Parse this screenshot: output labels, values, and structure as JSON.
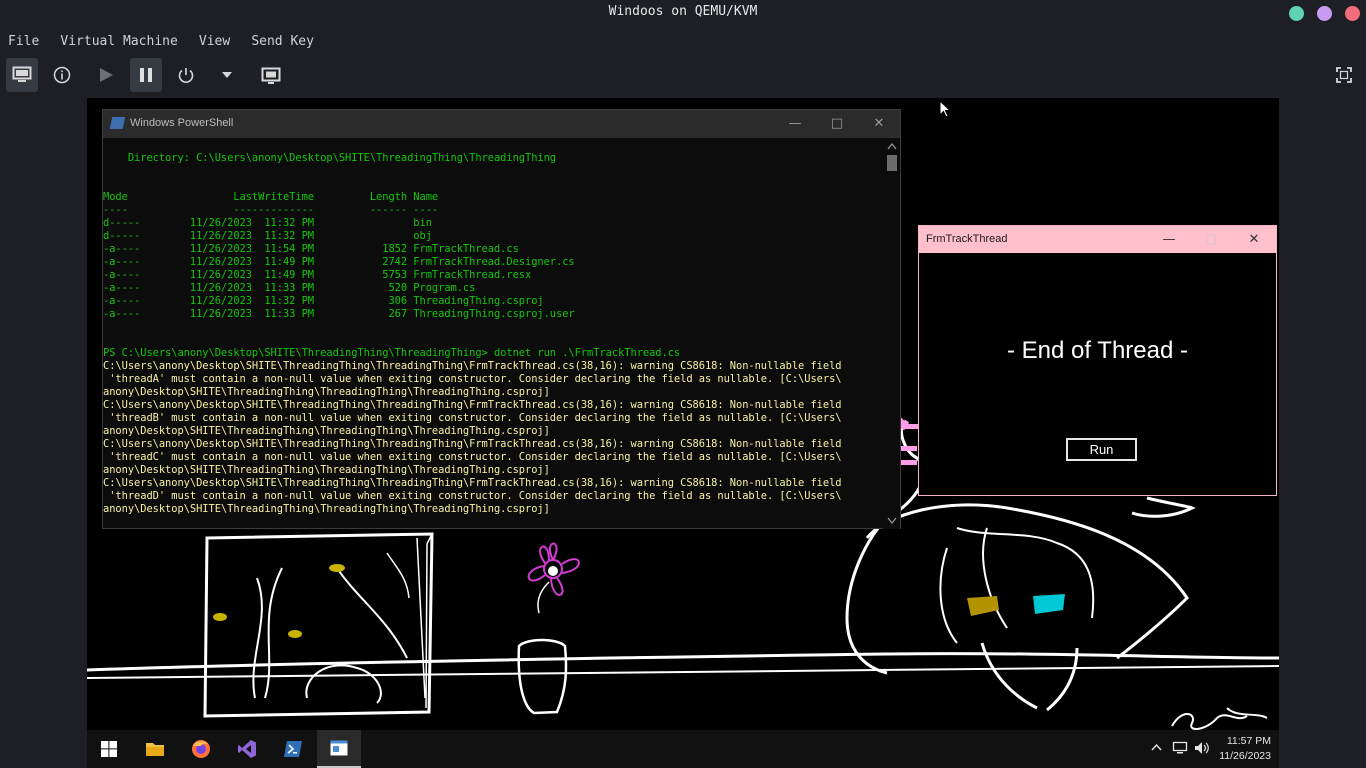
{
  "host": {
    "title": "Windoos on QEMU/KVM",
    "menu": [
      "File",
      "Virtual Machine",
      "View",
      "Send Key"
    ],
    "window_dots": [
      "#5fd3b3",
      "#c79cf2",
      "#f26d7d"
    ]
  },
  "powershell": {
    "title": "Windows PowerShell",
    "lines": [
      {
        "c": "g",
        "t": ""
      },
      {
        "c": "g",
        "t": "    Directory: C:\\Users\\anony\\Desktop\\SHITE\\ThreadingThing\\ThreadingThing"
      },
      {
        "c": "g",
        "t": ""
      },
      {
        "c": "g",
        "t": ""
      },
      {
        "c": "g",
        "t": "Mode                 LastWriteTime         Length Name"
      },
      {
        "c": "g",
        "t": "----                 -------------         ------ ----"
      },
      {
        "c": "g",
        "t": "d-----        11/26/2023  11:32 PM                bin"
      },
      {
        "c": "g",
        "t": "d-----        11/26/2023  11:32 PM                obj"
      },
      {
        "c": "g",
        "t": "-a----        11/26/2023  11:54 PM           1852 FrmTrackThread.cs"
      },
      {
        "c": "g",
        "t": "-a----        11/26/2023  11:49 PM           2742 FrmTrackThread.Designer.cs"
      },
      {
        "c": "g",
        "t": "-a----        11/26/2023  11:49 PM           5753 FrmTrackThread.resx"
      },
      {
        "c": "g",
        "t": "-a----        11/26/2023  11:33 PM            520 Program.cs"
      },
      {
        "c": "g",
        "t": "-a----        11/26/2023  11:32 PM            306 ThreadingThing.csproj"
      },
      {
        "c": "g",
        "t": "-a----        11/26/2023  11:33 PM            267 ThreadingThing.csproj.user"
      },
      {
        "c": "g",
        "t": ""
      },
      {
        "c": "g",
        "t": ""
      },
      {
        "c": "g",
        "t": "PS C:\\Users\\anony\\Desktop\\SHITE\\ThreadingThing\\ThreadingThing> dotnet run .\\FrmTrackThread.cs"
      },
      {
        "c": "y",
        "t": "C:\\Users\\anony\\Desktop\\SHITE\\ThreadingThing\\ThreadingThing\\FrmTrackThread.cs(38,16): warning CS8618: Non-nullable field"
      },
      {
        "c": "y",
        "t": " 'threadA' must contain a non-null value when exiting constructor. Consider declaring the field as nullable. [C:\\Users\\"
      },
      {
        "c": "y",
        "t": "anony\\Desktop\\SHITE\\ThreadingThing\\ThreadingThing\\ThreadingThing.csproj]"
      },
      {
        "c": "y",
        "t": "C:\\Users\\anony\\Desktop\\SHITE\\ThreadingThing\\ThreadingThing\\FrmTrackThread.cs(38,16): warning CS8618: Non-nullable field"
      },
      {
        "c": "y",
        "t": " 'threadB' must contain a non-null value when exiting constructor. Consider declaring the field as nullable. [C:\\Users\\"
      },
      {
        "c": "y",
        "t": "anony\\Desktop\\SHITE\\ThreadingThing\\ThreadingThing\\ThreadingThing.csproj]"
      },
      {
        "c": "y",
        "t": "C:\\Users\\anony\\Desktop\\SHITE\\ThreadingThing\\ThreadingThing\\FrmTrackThread.cs(38,16): warning CS8618: Non-nullable field"
      },
      {
        "c": "y",
        "t": " 'threadC' must contain a non-null value when exiting constructor. Consider declaring the field as nullable. [C:\\Users\\"
      },
      {
        "c": "y",
        "t": "anony\\Desktop\\SHITE\\ThreadingThing\\ThreadingThing\\ThreadingThing.csproj]"
      },
      {
        "c": "y",
        "t": "C:\\Users\\anony\\Desktop\\SHITE\\ThreadingThing\\ThreadingThing\\FrmTrackThread.cs(38,16): warning CS8618: Non-nullable field"
      },
      {
        "c": "y",
        "t": " 'threadD' must contain a non-null value when exiting constructor. Consider declaring the field as nullable. [C:\\Users\\"
      },
      {
        "c": "y",
        "t": "anony\\Desktop\\SHITE\\ThreadingThing\\ThreadingThing\\ThreadingThing.csproj]"
      }
    ]
  },
  "frm": {
    "title": "FrmTrackThread",
    "label": "- End of Thread -",
    "run_label": "Run"
  },
  "taskbar": {
    "time": "11:57 PM",
    "date": "11/26/2023"
  }
}
